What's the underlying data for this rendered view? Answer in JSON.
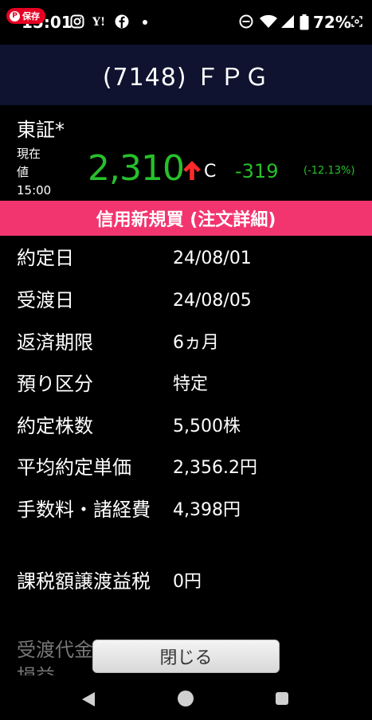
{
  "status_bar": {
    "time": "15:01",
    "pin_label": "保存",
    "battery": "72%"
  },
  "header": {
    "title": "(7148) ＦＰＧ"
  },
  "quote": {
    "market": "東証*",
    "price_label_line1": "現在",
    "price_label_line2": "値",
    "price_time": "15:00",
    "price": "2,310",
    "price_mark": "C",
    "change": "-319",
    "change_pct": "(-12.13%)"
  },
  "section": {
    "title": "信用新規買 (注文詳細)"
  },
  "details": [
    {
      "label": "約定日",
      "value": "24/08/01"
    },
    {
      "label": "受渡日",
      "value": "24/08/05"
    },
    {
      "label": "返済期限",
      "value": "6ヵ月"
    },
    {
      "label": "預り区分",
      "value": "特定"
    },
    {
      "label": "約定株数",
      "value": "5,500株"
    },
    {
      "label": "平均約定単価",
      "value": "2,356.2円"
    },
    {
      "label": "手数料・諸経費",
      "value": "4,398円"
    },
    {
      "label": "課税額譲渡益税",
      "value": "0円"
    }
  ],
  "partial_row": {
    "label_line1": "受渡代金",
    "label_line2": "損益"
  },
  "close_button": {
    "label": "閉じる"
  },
  "colors": {
    "header_bg": "#0f1330",
    "banner_bg": "#f2356f",
    "price_green": "#27c02b",
    "arrow_red": "#ff2a2a"
  }
}
